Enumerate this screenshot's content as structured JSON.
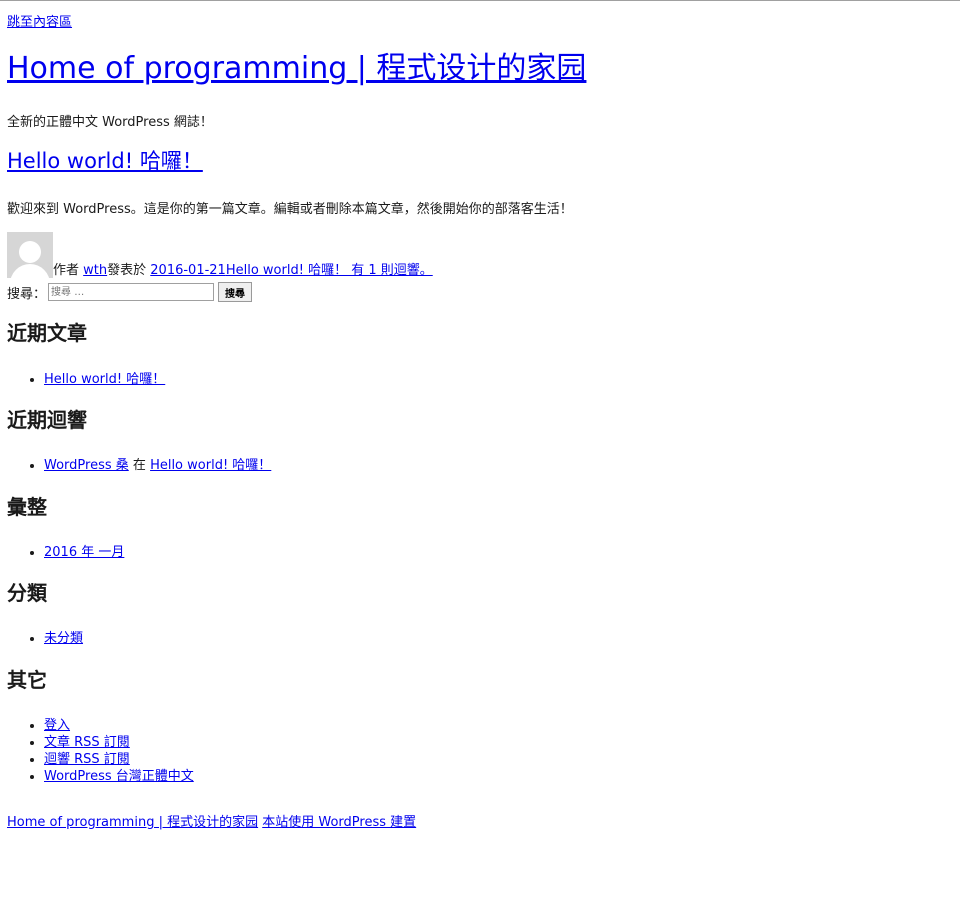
{
  "skip_link": "跳至內容區",
  "site": {
    "title": "Home of programming | 程式设计的家园",
    "tagline": "全新的正體中文 WordPress 網誌！"
  },
  "post": {
    "title": "Hello world! 哈囉！",
    "body": "歡迎來到 WordPress。這是你的第一篇文章。編輯或者刪除本篇文章，然後開始你的部落客生活！",
    "meta": {
      "author_prefix": "作者",
      "author": "wth",
      "published_prefix": "發表於",
      "date": "2016-01-21",
      "comments_link": "Hello world! 哈囉！ 有 1 則迴響。"
    }
  },
  "search": {
    "label": "搜尋：",
    "placeholder": "搜尋 …",
    "button": "搜尋"
  },
  "widgets": {
    "recent_posts": {
      "title": "近期文章",
      "items": [
        "Hello world! 哈囉！"
      ]
    },
    "recent_comments": {
      "title": "近期迴響",
      "author": "WordPress 桑",
      "connector": "在",
      "post": "Hello world! 哈囉！"
    },
    "archives": {
      "title": "彙整",
      "items": [
        "2016 年 一月"
      ]
    },
    "categories": {
      "title": "分類",
      "items": [
        "未分類"
      ]
    },
    "meta": {
      "title": "其它",
      "items": [
        "登入",
        "文章 RSS 訂閱",
        "迴響 RSS 訂閱",
        "WordPress 台灣正體中文"
      ]
    }
  },
  "footer": {
    "site_link": "Home of programming | 程式设计的家园",
    "powered": "本站使用 WordPress 建置"
  }
}
